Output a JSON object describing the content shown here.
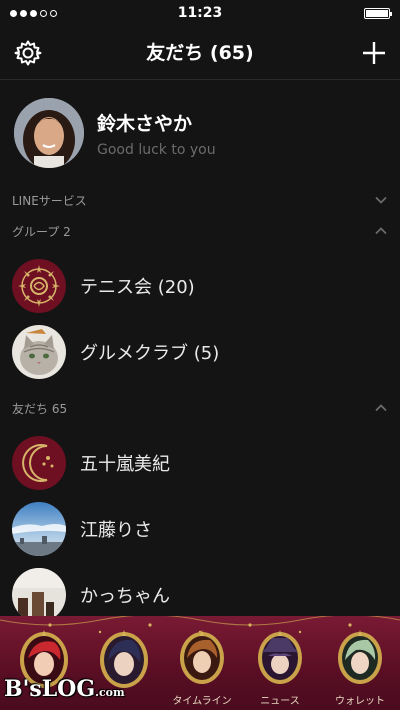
{
  "status_bar": {
    "time": "11:23",
    "signal_dots_filled": 3,
    "signal_dots_total": 5,
    "battery_level": 1.0
  },
  "nav": {
    "title": "友だち (65)"
  },
  "profile": {
    "name": "鈴木さやか",
    "status": "Good luck to you"
  },
  "sections": {
    "line_service": "LINEサービス",
    "groups": "グループ 2",
    "friends": "友だち 65"
  },
  "groups": [
    {
      "label": "テニス会 (20)",
      "icon": "tennis-club-emblem"
    },
    {
      "label": "グルメクラブ (5)",
      "icon": "cat-photo"
    }
  ],
  "friends": [
    {
      "label": "五十嵐美紀",
      "icon": "crescent-moon-emblem"
    },
    {
      "label": "江藤りさ",
      "icon": "sky-photo"
    },
    {
      "label": "かっちゃん",
      "icon": "room-photo"
    }
  ],
  "tabs": [
    {
      "label": "",
      "icon": "character-red-hair"
    },
    {
      "label": "",
      "icon": "character-dark-hair"
    },
    {
      "label": "タイムライン",
      "icon": "character-brown-hair"
    },
    {
      "label": "ニュース",
      "icon": "character-hat"
    },
    {
      "label": "ウォレット",
      "icon": "character-silver-hair"
    }
  ],
  "watermark": {
    "text": "B'sLOG",
    "suffix": ".com"
  },
  "colors": {
    "background": "#141414",
    "tab_bar": "#6a1430",
    "frame_gold": "#c9a24a",
    "emblem_red": "#7a1020"
  }
}
